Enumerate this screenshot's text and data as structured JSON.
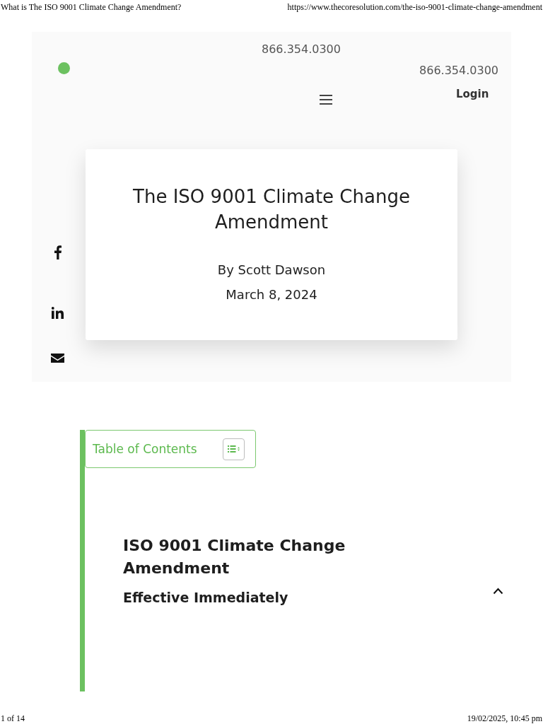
{
  "print_header": {
    "title": "What is The ISO 9001 Climate Change Amendment?",
    "url": "https://www.thecoresolution.com/the-iso-9001-climate-change-amendment"
  },
  "site_header": {
    "phone_numbers": [
      "866.354.0300",
      "866.354.0300"
    ],
    "login": "Login"
  },
  "share_buttons": [
    {
      "kind": "facebook"
    },
    {
      "kind": "linkedin"
    },
    {
      "kind": "email"
    }
  ],
  "hero": {
    "title": "The ISO 9001 Climate Change Amendment",
    "author": "By Scott Dawson",
    "date": "March 8, 2024"
  },
  "table_of_contents": {
    "title": "Table of Contents"
  },
  "article": {
    "heading": "ISO 9001 Climate Change Amendment",
    "subheading": "Effective Immediately"
  },
  "print_footer": {
    "page": "1 of 14",
    "timestamp": "19/02/2025, 10:45 pm"
  }
}
